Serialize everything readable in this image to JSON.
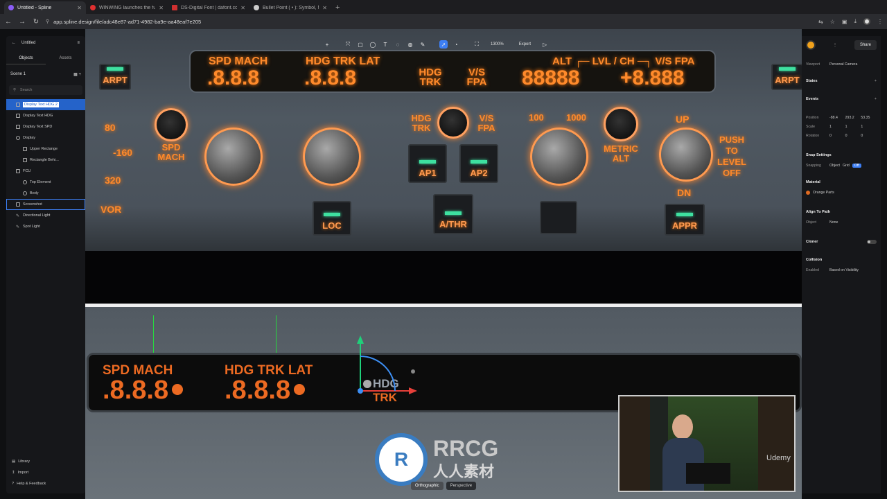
{
  "browser": {
    "tabs": [
      {
        "label": "Untitled - Spline",
        "color": "#8a5cf5",
        "active": true
      },
      {
        "label": "WINWING launches the full-...",
        "color": "#e03030",
        "active": false
      },
      {
        "label": "DS-Digital Font | dafont.com",
        "color": "#d03030",
        "active": false
      },
      {
        "label": "Bullet Point ( • ): Symbol, Me...",
        "color": "#cccccc",
        "active": false
      }
    ],
    "new_tab": "+",
    "url": "app.spline.design/file/adc48e87-ad71-4982-ba9e-aa48eaf7e205"
  },
  "left_panel": {
    "title": "Untitled",
    "tabs": [
      "Objects",
      "Assets"
    ],
    "scene": "Scene 1",
    "search_placeholder": "Search",
    "items": [
      {
        "label": "Display Text HDG 2",
        "depth": 1,
        "selected": true
      },
      {
        "label": "Display Text HDG",
        "depth": 1
      },
      {
        "label": "Display Text SPD",
        "depth": 1
      },
      {
        "label": "Display",
        "depth": 1
      },
      {
        "label": "Upper Rectange",
        "depth": 2
      },
      {
        "label": "Rectangle Behi...",
        "depth": 2
      },
      {
        "label": "FCU",
        "depth": 1
      },
      {
        "label": "Top Element",
        "depth": 2
      },
      {
        "label": "Body",
        "depth": 2
      },
      {
        "label": "Screenshot",
        "depth": 1,
        "highlight": true
      },
      {
        "label": "Directional Light",
        "depth": 1
      },
      {
        "label": "Spot Light",
        "depth": 1
      }
    ],
    "bottom": [
      "Library",
      "Import",
      "Help & Feedback"
    ]
  },
  "toolbar": {
    "zoom": "1300%",
    "export": "Export"
  },
  "right_panel": {
    "share": "Share",
    "viewport_label": "Viewport",
    "viewport_value": "Personal Camera",
    "states": "States",
    "events": "Events",
    "position": {
      "label": "Position",
      "x": "-88.4",
      "y": "293.2",
      "z": "53.35"
    },
    "scale": {
      "label": "Scale",
      "x": "1",
      "y": "1",
      "z": "1"
    },
    "rotation": {
      "label": "Rotation",
      "x": "0",
      "y": "0",
      "z": "0"
    },
    "snap_settings": "Snap Settings",
    "snapping": "Snapping",
    "snap_opts": [
      "Object",
      "Grid",
      "Off"
    ],
    "material": "Material",
    "material_value": "Orange Parts",
    "align": "Align To Path",
    "object_label": "Object",
    "object_value": "None",
    "cloner": "Cloner",
    "collision": "Collision",
    "enabled_label": "Enabled",
    "enabled_value": "Based on Visibility"
  },
  "fcu": {
    "spd_mach": "SPD MACH",
    "spd_val": ".8.8.8",
    "hdg_trk_lat": "HDG TRK LAT",
    "hdg_val": ".8.8.8",
    "hdg_trk": "HDG TRK",
    "vs_fpa": "V/S FPA",
    "alt_label": "ALT ┌─ LVL / CH ─┐ V/S FPA",
    "alt_val": "88888",
    "vs_val": "+8.888",
    "arpt": "ARPT",
    "ap1": "AP1",
    "ap2": "AP2",
    "loc": "LOC",
    "athr": "A/THR",
    "appr": "APPR",
    "spd_mach_label": "SPD MACH",
    "metric_alt": "METRIC ALT",
    "push_to_level_off": "PUSH TO LEVEL OFF",
    "up": "UP",
    "dn": "DN",
    "k100": "100",
    "k1000": "1000",
    "hdg_trk_small": "HDG TRK",
    "vs_fpa_small": "V/S FPA",
    "vor": "VOR",
    "n80": "80",
    "n160": "-160",
    "n320": "320"
  },
  "panel": {
    "spd_mach": "SPD MACH",
    "spd_val": ".8.8.8",
    "hdg_trk_lat": "HDG TRK LAT",
    "hdg_val": ".8.8.8",
    "hdg": "HDG",
    "trk": "TRK"
  },
  "view_toggle": [
    "Orthographic",
    "Perspective"
  ],
  "watermark": {
    "title": "RRCG",
    "subtitle": "人人素材"
  },
  "udemy": "Udemy"
}
